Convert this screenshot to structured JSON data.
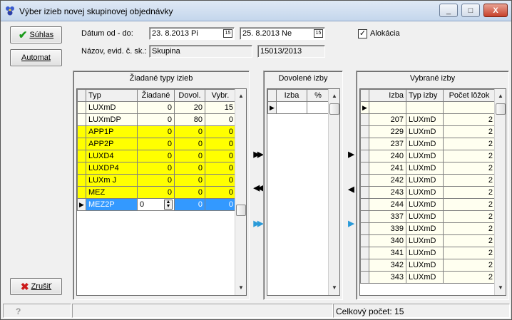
{
  "window": {
    "title": "Výber izieb novej skupinovej objednávky",
    "min": "_",
    "max": "□",
    "close": "X"
  },
  "buttons": {
    "suhlas": "Súhlas",
    "automat": "Automat",
    "zrusit": "Zrušiť"
  },
  "form": {
    "date_label": "Dátum od - do:",
    "date_from": "23. 8.2013  Pi",
    "date_to": "25. 8.2013  Ne",
    "calendar_glyph": "15",
    "name_label": "Názov, evid. č. sk.:",
    "name_value": "Skupina",
    "evid_value": "15013/2013",
    "alokacia_label": "Alokácia",
    "alokacia_checked": "✓"
  },
  "requested": {
    "title": "Žiadané typy izieb",
    "headers": [
      "Typ",
      "Žiadané",
      "Dovol.",
      "Vybr."
    ],
    "rows": [
      {
        "typ": "LUXmD",
        "ziadane": "0",
        "dovol": "20",
        "vybr": "15"
      },
      {
        "typ": "LUXmDP",
        "ziadane": "0",
        "dovol": "80",
        "vybr": "0"
      },
      {
        "typ": "APP1P",
        "ziadane": "0",
        "dovol": "0",
        "vybr": "0"
      },
      {
        "typ": "APP2P",
        "ziadane": "0",
        "dovol": "0",
        "vybr": "0"
      },
      {
        "typ": "LUXD4",
        "ziadane": "0",
        "dovol": "0",
        "vybr": "0"
      },
      {
        "typ": "LUXDP4",
        "ziadane": "0",
        "dovol": "0",
        "vybr": "0"
      },
      {
        "typ": "LUXm J",
        "ziadane": "0",
        "dovol": "0",
        "vybr": "0"
      },
      {
        "typ": "MEZ",
        "ziadane": "0",
        "dovol": "0",
        "vybr": "0"
      },
      {
        "typ": "MEZ2P",
        "ziadane": "0",
        "dovol": "0",
        "vybr": "0"
      }
    ]
  },
  "allowed": {
    "title": "Dovolené izby",
    "headers": [
      "Izba",
      "%"
    ]
  },
  "chosen": {
    "title": "Vybrané izby",
    "headers": [
      "Izba",
      "Typ izby",
      "Počet lôžok"
    ],
    "rows": [
      {
        "izba": "207",
        "typ": "LUXmD",
        "pocet": "2"
      },
      {
        "izba": "229",
        "typ": "LUXmD",
        "pocet": "2"
      },
      {
        "izba": "237",
        "typ": "LUXmD",
        "pocet": "2"
      },
      {
        "izba": "240",
        "typ": "LUXmD",
        "pocet": "2"
      },
      {
        "izba": "241",
        "typ": "LUXmD",
        "pocet": "2"
      },
      {
        "izba": "242",
        "typ": "LUXmD",
        "pocet": "2"
      },
      {
        "izba": "243",
        "typ": "LUXmD",
        "pocet": "2"
      },
      {
        "izba": "244",
        "typ": "LUXmD",
        "pocet": "2"
      },
      {
        "izba": "337",
        "typ": "LUXmD",
        "pocet": "2"
      },
      {
        "izba": "339",
        "typ": "LUXmD",
        "pocet": "2"
      },
      {
        "izba": "340",
        "typ": "LUXmD",
        "pocet": "2"
      },
      {
        "izba": "341",
        "typ": "LUXmD",
        "pocet": "2"
      },
      {
        "izba": "342",
        "typ": "LUXmD",
        "pocet": "2"
      },
      {
        "izba": "343",
        "typ": "LUXmD",
        "pocet": "2"
      }
    ]
  },
  "status": {
    "help": "?",
    "total": "Celkový počet: 15"
  }
}
